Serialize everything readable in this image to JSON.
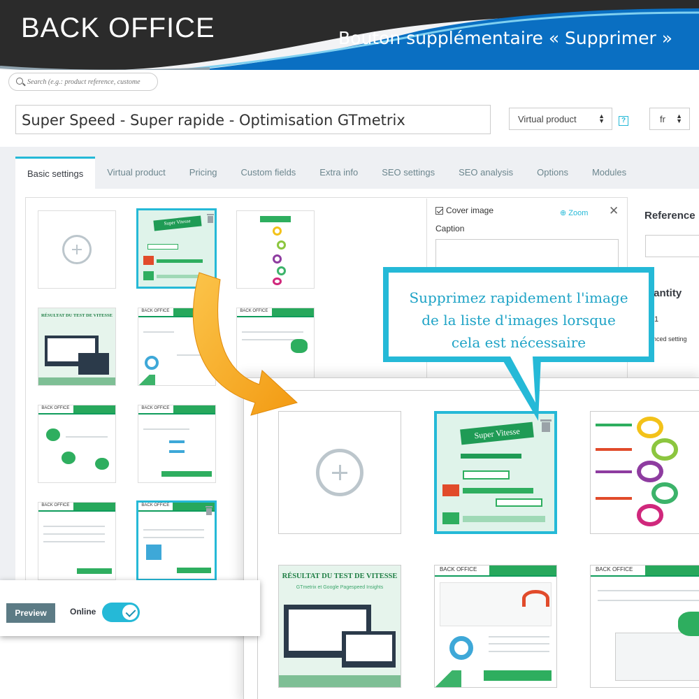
{
  "banner": {
    "title": "BACK OFFICE",
    "subtitle": "Bouton supplémentaire « Supprimer »"
  },
  "search": {
    "placeholder": "Search (e.g.: product reference, custome"
  },
  "product": {
    "name": "Super Speed - Super rapide - Optimisation GTmetrix",
    "type_selected": "Virtual product",
    "help": "?",
    "language_selected": "fr"
  },
  "tabs": [
    {
      "label": "Basic settings",
      "active": true
    },
    {
      "label": "Virtual product"
    },
    {
      "label": "Pricing"
    },
    {
      "label": "Custom fields"
    },
    {
      "label": "Extra info"
    },
    {
      "label": "SEO settings"
    },
    {
      "label": "SEO analysis"
    },
    {
      "label": "Options"
    },
    {
      "label": "Modules"
    }
  ],
  "image_panel": {
    "cover_image_label": "Cover image",
    "zoom_label": "Zoom",
    "close_symbol": "✕",
    "caption_label": "Caption"
  },
  "right_fields": {
    "reference_label": "Reference",
    "quantity_label": "uantity",
    "quantity_value": "1",
    "advanced_settings_label": "ranced setting"
  },
  "callout": {
    "lines": [
      "Supprimez rapidement l'image",
      "de la liste d'images lorsque",
      "cela est nécessaire"
    ]
  },
  "footer": {
    "preview_label": "Preview",
    "online_label": "Online",
    "online_enabled": true
  },
  "thumb_texts": {
    "super_vitesse": "Super Vitesse",
    "back_office": "BACK OFFICE",
    "resultat_title": "RÉSULTAT DU TEST DE VITESSE",
    "resultat_sub": "GTmetrix et Google Pagespeed Insights"
  },
  "colors": {
    "accent": "#25b9d7",
    "banner_dark": "#2b2b2b",
    "banner_blue": "#0a6fc2",
    "preview_button": "#5c7b85",
    "green": "#27a85c",
    "arrow_orange": "#f7a21b"
  }
}
